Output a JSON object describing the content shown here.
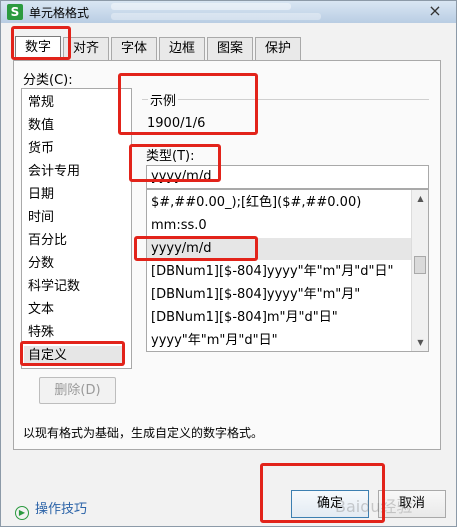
{
  "window": {
    "title": "单元格格式",
    "app_icon": "S",
    "close_symbol": "×"
  },
  "tabs": [
    {
      "label": "数字"
    },
    {
      "label": "对齐"
    },
    {
      "label": "字体"
    },
    {
      "label": "边框"
    },
    {
      "label": "图案"
    },
    {
      "label": "保护"
    }
  ],
  "category": {
    "label": "分类(C):",
    "items": [
      "常规",
      "数值",
      "货币",
      "会计专用",
      "日期",
      "时间",
      "百分比",
      "分数",
      "科学记数",
      "文本",
      "特殊",
      "自定义"
    ],
    "selected": "自定义"
  },
  "sample": {
    "label": "示例",
    "value": "1900/1/6"
  },
  "type": {
    "label": "类型(T):",
    "value": "yyyy/m/d",
    "items": [
      "$#,##0.00_);[红色]($#,##0.00)",
      "mm:ss.0",
      "yyyy/m/d",
      "[DBNum1][$-804]yyyy\"年\"m\"月\"d\"日\"",
      "[DBNum1][$-804]yyyy\"年\"m\"月\"",
      "[DBNum1][$-804]m\"月\"d\"日\"",
      "yyyy\"年\"m\"月\"d\"日\""
    ],
    "selected": "yyyy/m/d"
  },
  "buttons": {
    "delete": "删除(D)",
    "ok": "确定",
    "cancel": "取消"
  },
  "description": "以现有格式为基础，生成自定义的数字格式。",
  "tips": {
    "label": "操作技巧"
  },
  "watermark": "Baidu经验",
  "colors": {
    "highlight_box": "#e2231a",
    "title_gradient_top": "#d9e6f3",
    "app_icon_green": "#2b9a3f",
    "link_blue": "#2b63a8"
  }
}
